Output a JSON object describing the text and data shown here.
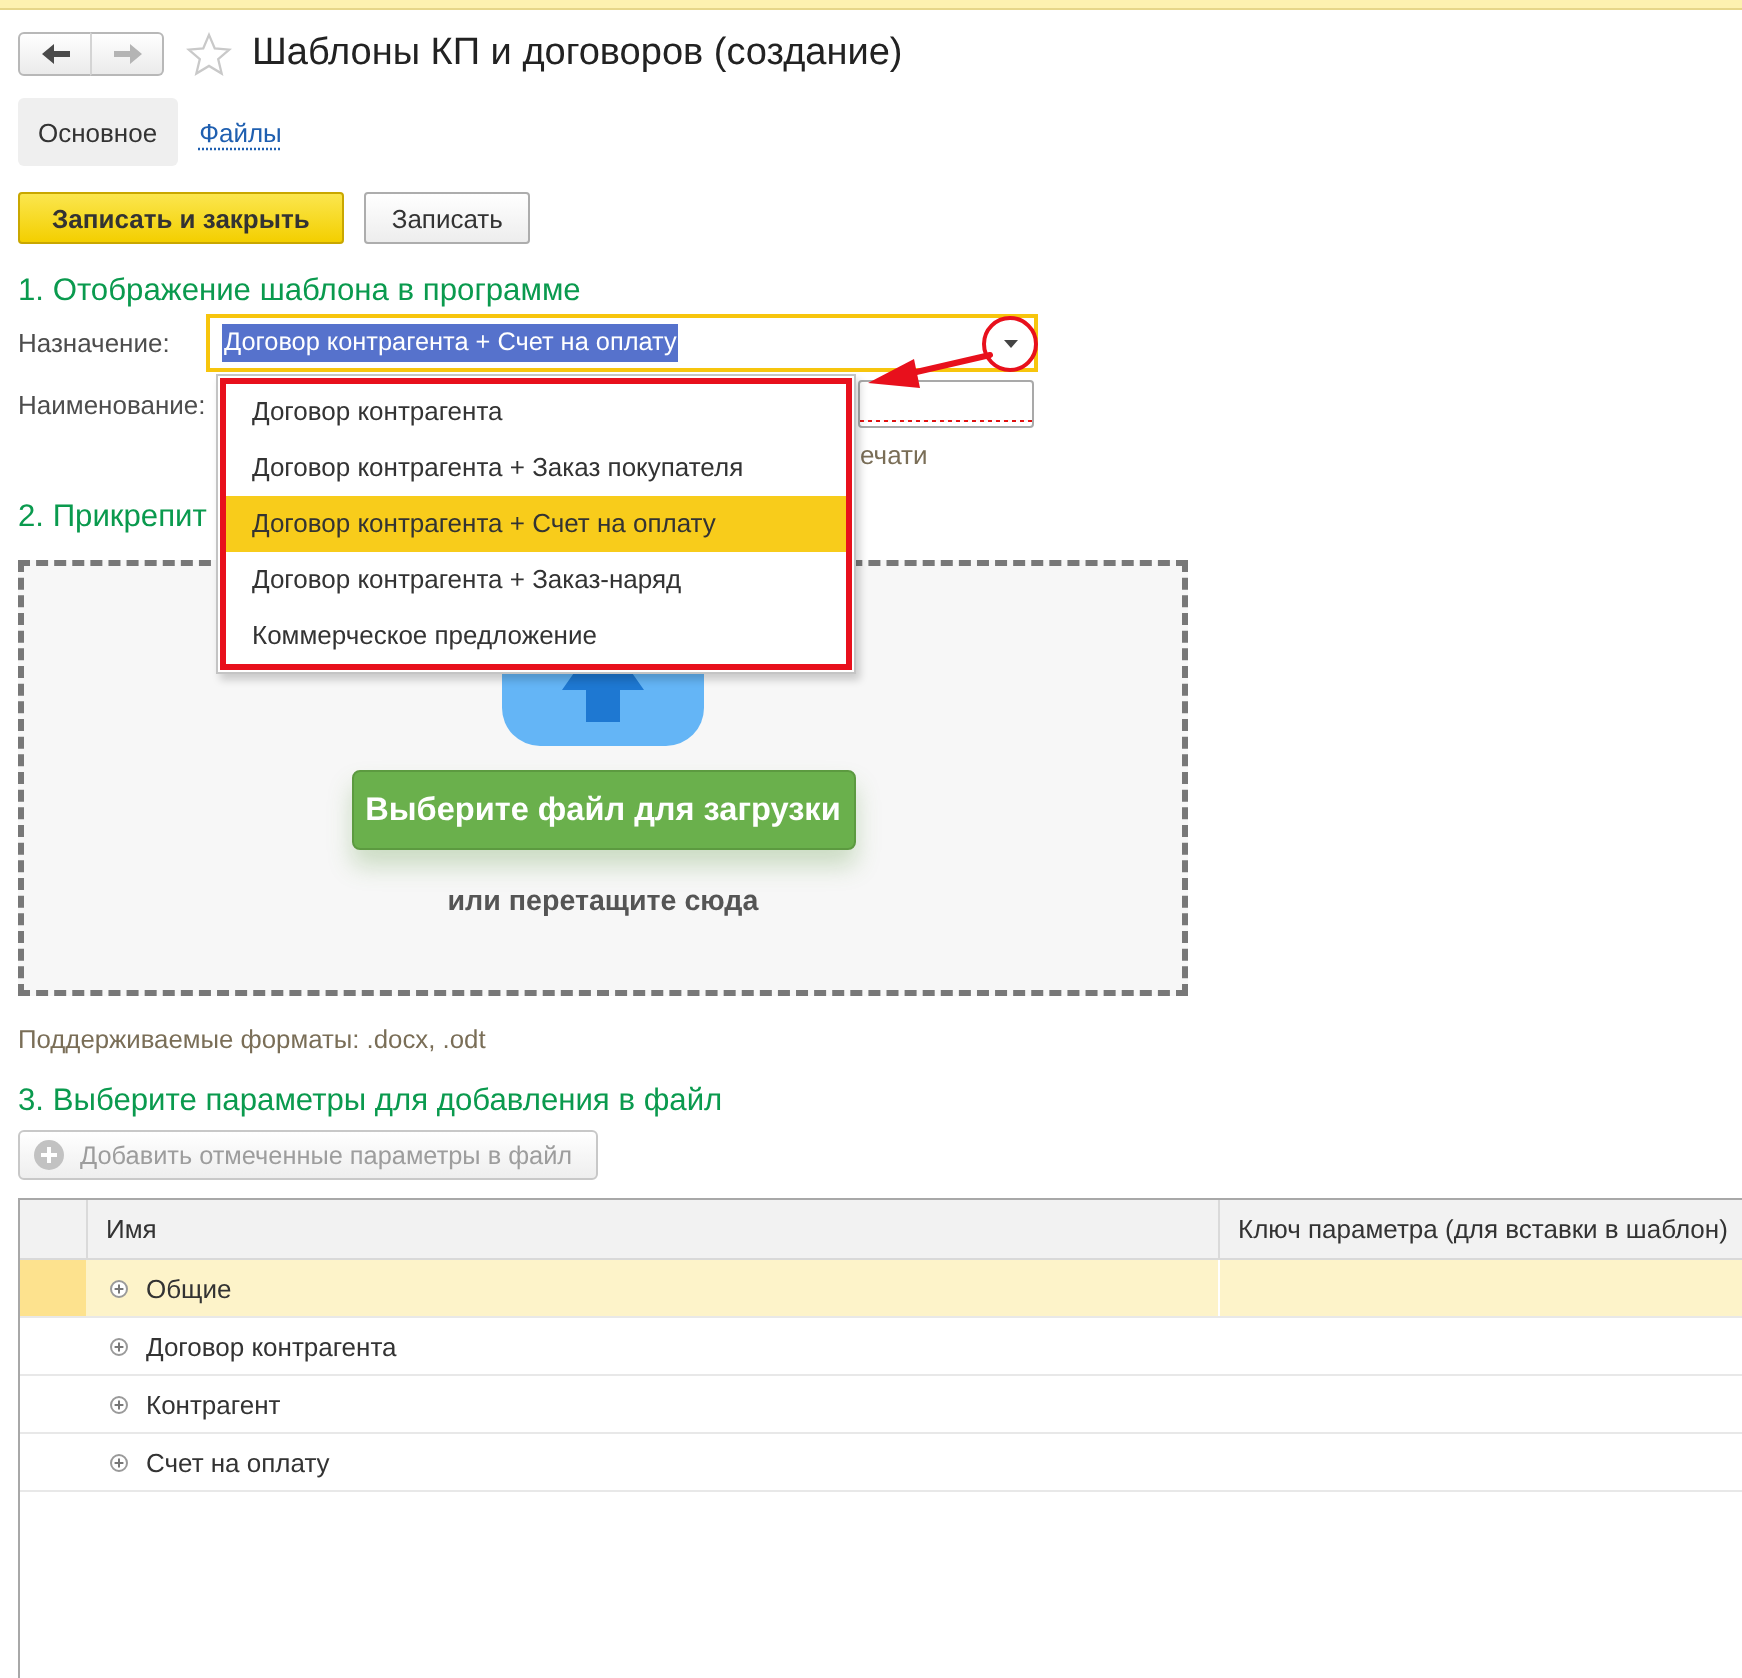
{
  "window": {
    "title": "Шаблоны КП и договоров (создание)",
    "favorite": false
  },
  "nav": [
    {
      "kind": "back",
      "disabled": false
    },
    {
      "kind": "forward",
      "disabled": true
    }
  ],
  "tabs": [
    {
      "label": "Основное",
      "selected": true
    },
    {
      "label": "Файлы",
      "selected": false
    }
  ],
  "toolbar": [
    {
      "label": "Записать и закрыть",
      "kind": "primary"
    },
    {
      "label": "Записать",
      "kind": "default"
    }
  ],
  "display_section": {
    "heading": "1. Отображение шаблона в программе",
    "purpose": {
      "label": "Назначение:",
      "value": "Договор контрагента + Счет на оплату",
      "text_selected": true,
      "dropdown_open": true,
      "options": [
        {
          "label": "Договор контрагента",
          "selected": false
        },
        {
          "label": "Договор контрагента + Заказ покупателя",
          "selected": false
        },
        {
          "label": "Договор контрагента + Счет на оплату",
          "selected": true
        },
        {
          "label": "Договор контрагента + Заказ-наряд",
          "selected": false
        },
        {
          "label": "Коммерческое предложение",
          "selected": false
        }
      ]
    },
    "name": {
      "label": "Наименование:",
      "required": true
    },
    "hint": "ечати"
  },
  "attach_section": {
    "heading": "2. Прикрепит",
    "upload_button": "Выберите файл для загрузки",
    "drop_hint": "или перетащите сюда",
    "formats_note": "Поддерживаемые форматы: .docx, .odt"
  },
  "params_section": {
    "heading": "3. Выберите параметры для добавления в файл",
    "add_button": {
      "label": "Добавить отмеченные параметры в файл",
      "disabled": true
    },
    "table": {
      "columns": [
        "Имя",
        "Ключ параметра (для вставки в шаблон)"
      ],
      "rows": [
        {
          "name": "Общие",
          "selected": true,
          "expanded": false
        },
        {
          "name": "Договор контрагента",
          "selected": false,
          "expanded": false
        },
        {
          "name": "Контрагент",
          "selected": false,
          "expanded": false
        },
        {
          "name": "Счет на оплату",
          "selected": false,
          "expanded": false
        }
      ]
    }
  }
}
